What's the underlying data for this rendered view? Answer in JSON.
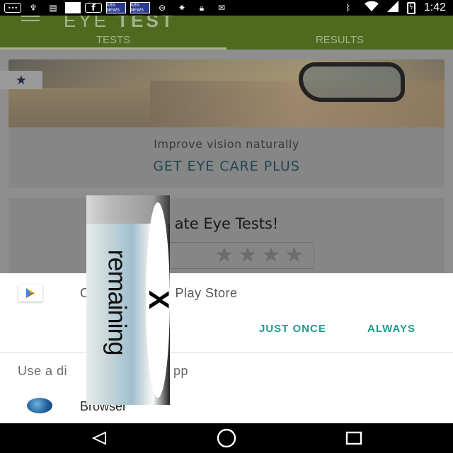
{
  "status_bar": {
    "time": "1:42",
    "left_icons": [
      "message-icon",
      "usb-icon",
      "chat-icon",
      "white-square-icon",
      "facebook-icon",
      "kbs-news-icon",
      "kbs-news-icon",
      "do-not-disturb-icon",
      "fan-icon",
      "lock-icon",
      "inbox-icon"
    ],
    "right_icons": [
      "bluetooth-icon",
      "wifi-icon",
      "signal-icon",
      "battery-icon"
    ],
    "kbs_label": "KBS NEWS"
  },
  "app": {
    "title_part1": "EYE",
    "title_part2": "TEST",
    "tabs": [
      {
        "label": "TESTS",
        "active": true
      },
      {
        "label": "RESULTS",
        "active": false
      }
    ],
    "promo": {
      "subtitle": "Improve vision naturally",
      "cta": "GET EYE CARE PLUS"
    },
    "rate": {
      "title_visible": "ate Eye Tests!",
      "stars": 5
    }
  },
  "sheet": {
    "open_with_partial_1": "O",
    "open_with_partial_2": "Play Store",
    "buttons": {
      "just_once": "JUST ONCE",
      "always": "ALWAYS"
    },
    "use_different_partial_1": "Use a di",
    "use_different_partial_2": "pp",
    "browser_label": "Browser"
  },
  "overlay": {
    "text": "remaining",
    "close_glyph": "X"
  },
  "colors": {
    "accent": "#1e9c8e",
    "app_bar": "#4f6a1e",
    "scrim": "#8e8e8e"
  }
}
